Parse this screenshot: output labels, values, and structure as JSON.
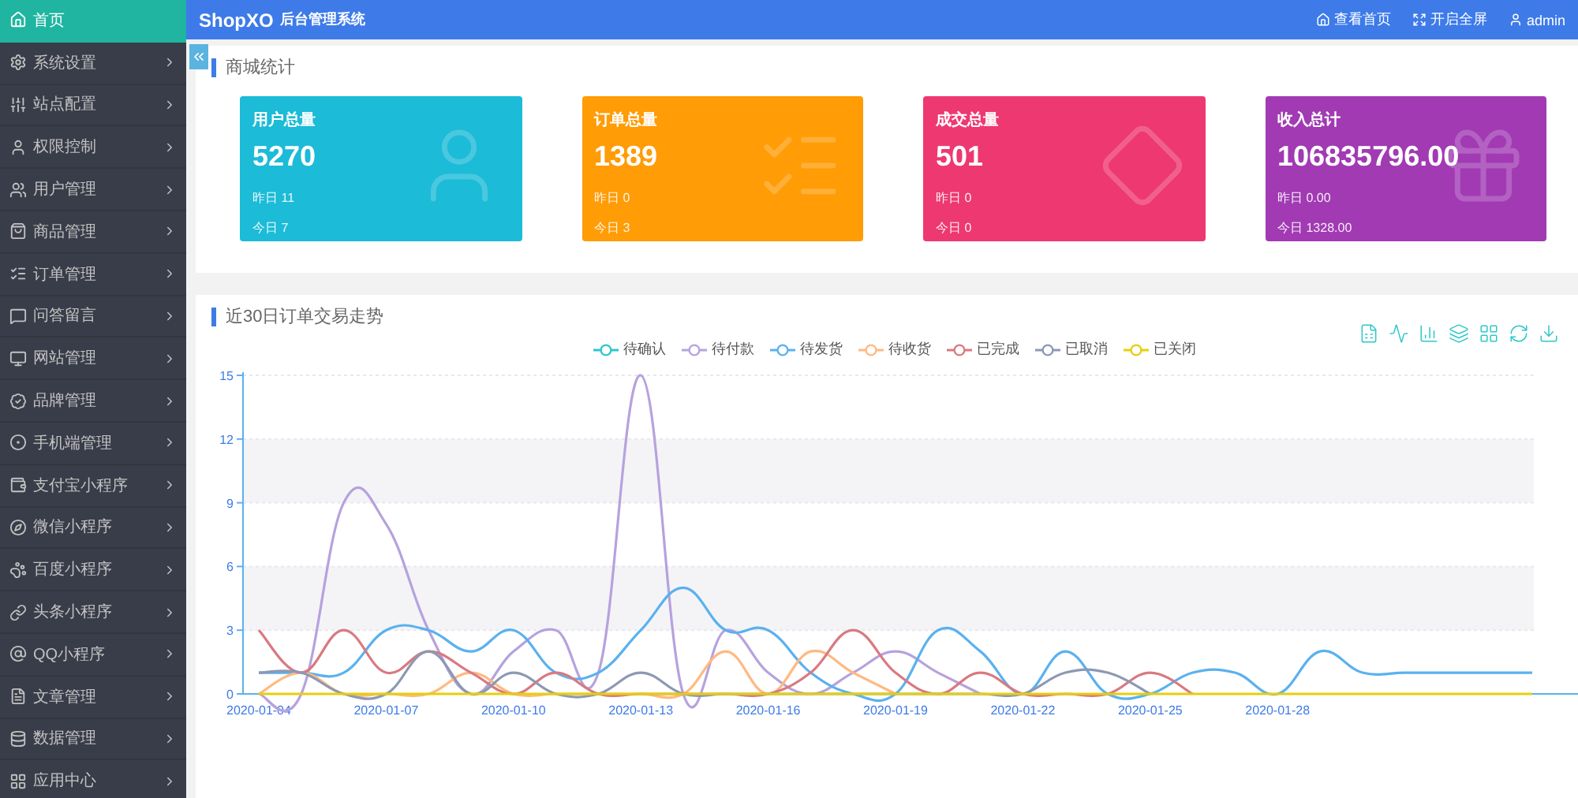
{
  "sidebar": {
    "items": [
      {
        "label": "首页",
        "selected": true
      },
      {
        "label": "系统设置",
        "selected": false
      },
      {
        "label": "站点配置",
        "selected": false
      },
      {
        "label": "权限控制",
        "selected": false
      },
      {
        "label": "用户管理",
        "selected": false
      },
      {
        "label": "商品管理",
        "selected": false
      },
      {
        "label": "订单管理",
        "selected": false
      },
      {
        "label": "问答留言",
        "selected": false
      },
      {
        "label": "网站管理",
        "selected": false
      },
      {
        "label": "品牌管理",
        "selected": false
      },
      {
        "label": "手机端管理",
        "selected": false
      },
      {
        "label": "支付宝小程序",
        "selected": false
      },
      {
        "label": "微信小程序",
        "selected": false
      },
      {
        "label": "百度小程序",
        "selected": false
      },
      {
        "label": "头条小程序",
        "selected": false
      },
      {
        "label": "QQ小程序",
        "selected": false
      },
      {
        "label": "文章管理",
        "selected": false
      },
      {
        "label": "数据管理",
        "selected": false
      },
      {
        "label": "应用中心",
        "selected": false
      }
    ]
  },
  "header": {
    "brand": "ShopXO",
    "subtitle": "后台管理系统",
    "links": [
      "查看首页",
      "开启全屏",
      "admin"
    ]
  },
  "stats": {
    "title": "商城统计",
    "cards": [
      {
        "title": "用户总量",
        "value": "5270",
        "yesterday": "昨日 11",
        "today": "今日 7",
        "color": "#1cbbd8"
      },
      {
        "title": "订单总量",
        "value": "1389",
        "yesterday": "昨日 0",
        "today": "今日 3",
        "color": "#ff9c06"
      },
      {
        "title": "成交总量",
        "value": "501",
        "yesterday": "昨日 0",
        "today": "今日 0",
        "color": "#ee3872"
      },
      {
        "title": "收入总计",
        "value": "106835796.00",
        "yesterday": "昨日 0.00",
        "today": "今日 1328.00",
        "color": "#a13ab3"
      }
    ]
  },
  "trend": {
    "title": "近30日订单交易走势",
    "chart_data": {
      "type": "line",
      "grid": true,
      "ylim": [
        0,
        15
      ],
      "yticks": [
        0,
        3,
        6,
        9,
        12,
        15
      ],
      "categories": [
        "2020-01-04",
        null,
        null,
        "2020-01-07",
        null,
        null,
        "2020-01-10",
        null,
        null,
        "2020-01-13",
        null,
        null,
        "2020-01-16",
        null,
        null,
        "2020-01-19",
        null,
        null,
        "2020-01-22",
        null,
        null,
        "2020-01-25",
        null,
        null,
        "2020-01-28",
        null,
        null,
        null,
        null,
        null,
        null
      ],
      "series": [
        {
          "name": "待确认",
          "color": "#2ec7c9",
          "values": [
            null,
            null,
            null,
            null,
            null,
            null,
            null,
            null,
            null,
            null,
            null,
            null,
            null,
            null,
            null,
            null,
            null,
            null,
            null,
            null,
            null,
            null,
            null,
            null,
            null,
            null,
            null,
            null,
            null,
            null,
            null
          ]
        },
        {
          "name": "待付款",
          "color": "#b6a2de",
          "values": [
            0,
            0,
            9,
            8,
            3,
            0,
            2,
            3,
            1,
            15,
            0,
            3,
            1,
            0,
            1,
            2,
            1,
            0,
            null,
            null,
            null,
            null,
            null,
            null,
            null,
            null,
            null,
            null,
            null,
            null,
            null
          ]
        },
        {
          "name": "待发货",
          "color": "#5ab1ef",
          "values": [
            1,
            1,
            1,
            3,
            3,
            2,
            3,
            1,
            1,
            3,
            5,
            3,
            3,
            1,
            0,
            0,
            3,
            2,
            0,
            2,
            0,
            0,
            1,
            1,
            0,
            2,
            1,
            1,
            1,
            1,
            1
          ]
        },
        {
          "name": "待收货",
          "color": "#ffb980",
          "values": [
            0,
            1,
            0,
            0,
            0,
            1,
            0,
            0,
            0,
            0,
            0,
            2,
            0,
            2,
            1,
            0,
            null,
            null,
            null,
            null,
            null,
            null,
            null,
            null,
            null,
            null,
            null,
            null,
            null,
            null,
            null
          ]
        },
        {
          "name": "已完成",
          "color": "#d87a80",
          "values": [
            3,
            1,
            3,
            1,
            2,
            1,
            0,
            1,
            0,
            0,
            0,
            0,
            0,
            1,
            3,
            1,
            0,
            1,
            0,
            0,
            0,
            1,
            0,
            null,
            null,
            null,
            null,
            null,
            null,
            null,
            null
          ]
        },
        {
          "name": "已取消",
          "color": "#8d98b3",
          "values": [
            1,
            1,
            0,
            0,
            2,
            0,
            1,
            0,
            0,
            1,
            0,
            0,
            0,
            0,
            0,
            0,
            0,
            0,
            0,
            1,
            1,
            0,
            null,
            null,
            null,
            null,
            null,
            null,
            null,
            null,
            null
          ]
        },
        {
          "name": "已关闭",
          "color": "#e5cf0d",
          "values": [
            0,
            0,
            0,
            0,
            0,
            0,
            0,
            0,
            0,
            0,
            0,
            0,
            0,
            0,
            0,
            0,
            0,
            0,
            0,
            0,
            0,
            0,
            0,
            0,
            0,
            0,
            0,
            0,
            0,
            0,
            0
          ]
        }
      ]
    }
  }
}
